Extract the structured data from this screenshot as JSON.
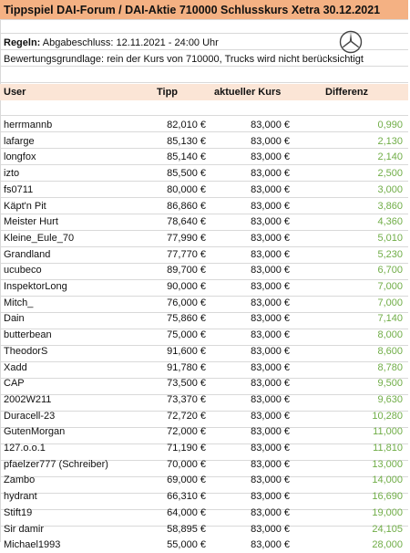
{
  "title": "Tippspiel DAI-Forum / DAI-Aktie 710000 Schlusskurs Xetra 30.12.2021",
  "rules": {
    "label": "Regeln:",
    "deadline": "Abgabeschluss: 12.11.2021 - 24:00 Uhr",
    "basis": "Bewertungsgrundlage: rein der Kurs von 710000, Trucks wird nicht berücksichtigt"
  },
  "logo_icon": "mercedes-star-icon",
  "columns": {
    "user": "User",
    "tipp": "Tipp",
    "kurs": "aktueller Kurs",
    "diff": "Differenz"
  },
  "colors": {
    "title_bg": "#f4b183",
    "header_bg": "#fbe5d6",
    "diff_text": "#70ad47"
  },
  "rows": [
    {
      "user": "herrmannb",
      "tipp": "82,010 €",
      "kurs": "83,000 €",
      "diff": "0,990"
    },
    {
      "user": "lafarge",
      "tipp": "85,130 €",
      "kurs": "83,000 €",
      "diff": "2,130"
    },
    {
      "user": "longfox",
      "tipp": "85,140 €",
      "kurs": "83,000 €",
      "diff": "2,140"
    },
    {
      "user": "izto",
      "tipp": "85,500 €",
      "kurs": "83,000 €",
      "diff": "2,500"
    },
    {
      "user": "fs0711",
      "tipp": "80,000 €",
      "kurs": "83,000 €",
      "diff": "3,000"
    },
    {
      "user": "Käpt'n Pit",
      "tipp": "86,860 €",
      "kurs": "83,000 €",
      "diff": "3,860"
    },
    {
      "user": "Meister Hurt",
      "tipp": "78,640 €",
      "kurs": "83,000 €",
      "diff": "4,360"
    },
    {
      "user": "Kleine_Eule_70",
      "tipp": "77,990 €",
      "kurs": "83,000 €",
      "diff": "5,010"
    },
    {
      "user": "Grandland",
      "tipp": "77,770 €",
      "kurs": "83,000 €",
      "diff": "5,230"
    },
    {
      "user": "ucubeco",
      "tipp": "89,700 €",
      "kurs": "83,000 €",
      "diff": "6,700"
    },
    {
      "user": "InspektorLong",
      "tipp": "90,000 €",
      "kurs": "83,000 €",
      "diff": "7,000"
    },
    {
      "user": "Mitch_",
      "tipp": "76,000 €",
      "kurs": "83,000 €",
      "diff": "7,000"
    },
    {
      "user": "Dain",
      "tipp": "75,860 €",
      "kurs": "83,000 €",
      "diff": "7,140"
    },
    {
      "user": "butterbean",
      "tipp": "75,000 €",
      "kurs": "83,000 €",
      "diff": "8,000"
    },
    {
      "user": "TheodorS",
      "tipp": "91,600 €",
      "kurs": "83,000 €",
      "diff": "8,600"
    },
    {
      "user": "Xadd",
      "tipp": "91,780 €",
      "kurs": "83,000 €",
      "diff": "8,780"
    },
    {
      "user": "CAP",
      "tipp": "73,500 €",
      "kurs": "83,000 €",
      "diff": "9,500"
    },
    {
      "user": "2002W211",
      "tipp": "73,370 €",
      "kurs": "83,000 €",
      "diff": "9,630"
    },
    {
      "user": "Duracell-23",
      "tipp": "72,720 €",
      "kurs": "83,000 €",
      "diff": "10,280"
    },
    {
      "user": "GutenMorgan",
      "tipp": "72,000 €",
      "kurs": "83,000 €",
      "diff": "11,000"
    },
    {
      "user": "127.o.o.1",
      "tipp": "71,190 €",
      "kurs": "83,000 €",
      "diff": "11,810"
    },
    {
      "user": "pfaelzer777 (Schreiber)",
      "tipp": "70,000 €",
      "kurs": "83,000 €",
      "diff": "13,000"
    },
    {
      "user": "Zambo",
      "tipp": "69,000 €",
      "kurs": "83,000 €",
      "diff": "14,000"
    },
    {
      "user": "hydrant",
      "tipp": "66,310 €",
      "kurs": "83,000 €",
      "diff": "16,690"
    },
    {
      "user": "Stift19",
      "tipp": "64,000 €",
      "kurs": "83,000 €",
      "diff": "19,000"
    },
    {
      "user": "Sir damir",
      "tipp": "58,895 €",
      "kurs": "83,000 €",
      "diff": "24,105"
    },
    {
      "user": "Michael1993",
      "tipp": "55,000 €",
      "kurs": "83,000 €",
      "diff": "28,000"
    }
  ]
}
